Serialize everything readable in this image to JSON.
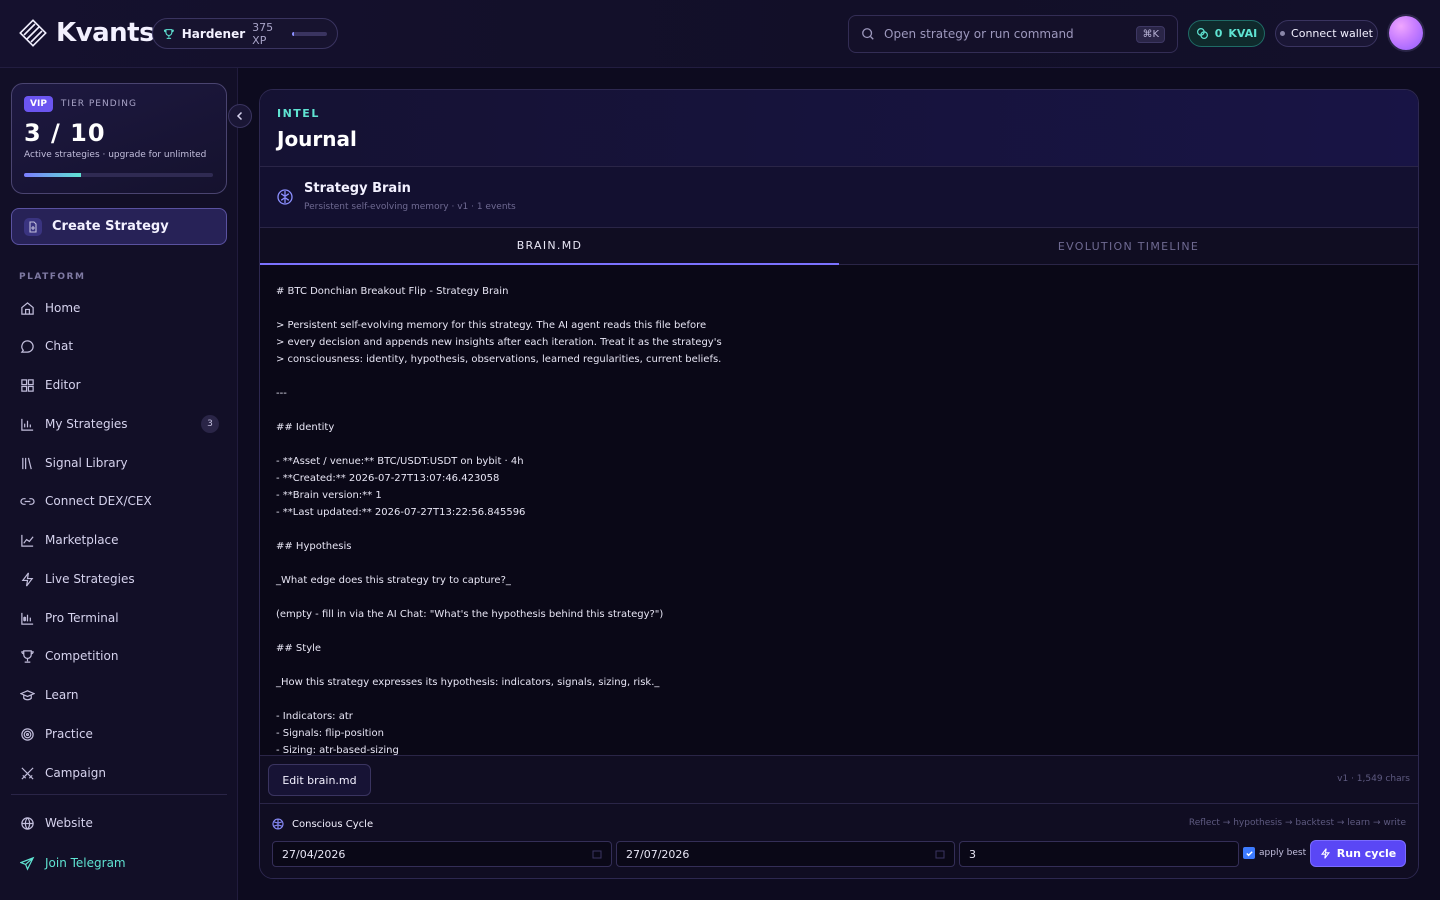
{
  "header": {
    "brand": "Kvants",
    "user_rank": "Hardener",
    "xp": "375 XP",
    "xp_progress": 0.06,
    "search_placeholder": "Open strategy or run command",
    "search_shortcut": "⌘K",
    "kvai_balance": "0",
    "kvai_unit": "KVAI",
    "connect_wallet": "Connect wallet"
  },
  "sidebar": {
    "vip_badge": "VIP",
    "tier_status": "TIER PENDING",
    "strategy_count": "3 / 10",
    "strategy_sub": "Active strategies · upgrade for unlimited",
    "strategy_progress": 0.3,
    "create_label": "Create Strategy",
    "section_label": "PLATFORM",
    "items": [
      {
        "label": "Home",
        "icon": "home-icon"
      },
      {
        "label": "Chat",
        "icon": "chat-icon"
      },
      {
        "label": "Editor",
        "icon": "grid-icon"
      },
      {
        "label": "My Strategies",
        "icon": "bar-chart-icon",
        "badge": "3"
      },
      {
        "label": "Signal Library",
        "icon": "library-icon"
      },
      {
        "label": "Connect DEX/CEX",
        "icon": "link-icon"
      },
      {
        "label": "Marketplace",
        "icon": "trend-icon"
      },
      {
        "label": "Live Strategies",
        "icon": "bolt-icon"
      },
      {
        "label": "Pro Terminal",
        "icon": "terminal-icon"
      },
      {
        "label": "Competition",
        "icon": "trophy-icon"
      },
      {
        "label": "Learn",
        "icon": "graduation-icon"
      },
      {
        "label": "Practice",
        "icon": "target-icon"
      },
      {
        "label": "Campaign",
        "icon": "swords-icon"
      }
    ],
    "footer_items": [
      {
        "label": "Website",
        "icon": "globe-icon"
      },
      {
        "label": "Join Telegram",
        "icon": "send-icon"
      }
    ]
  },
  "main": {
    "eyebrow": "INTEL",
    "title": "Journal",
    "brain_title": "Strategy Brain",
    "brain_sub": "Persistent self-evolving memory · v1 · 1 events",
    "tabs": [
      {
        "label": "BRAIN.MD",
        "active": true
      },
      {
        "label": "EVOLUTION TIMELINE",
        "active": false
      }
    ],
    "brain_lines": [
      "# BTC Donchian Breakout Flip - Strategy Brain",
      "",
      "> Persistent self-evolving memory for this strategy. The AI agent reads this file before",
      "> every decision and appends new insights after each iteration. Treat it as the strategy's",
      "> consciousness: identity, hypothesis, observations, learned regularities, current beliefs.",
      "",
      "---",
      "",
      "## Identity",
      "",
      "- **Asset / venue:** BTC/USDT:USDT on bybit · 4h",
      "- **Created:** 2026-07-27T13:07:46.423058",
      "- **Brain version:** 1",
      "- **Last updated:** 2026-07-27T13:22:56.845596",
      "",
      "## Hypothesis",
      "",
      "_What edge does this strategy try to capture?_",
      "",
      "(empty - fill in via the AI Chat: \"What's the hypothesis behind this strategy?\")",
      "",
      "## Style",
      "",
      "_How this strategy expresses its hypothesis: indicators, signals, sizing, risk._",
      "",
      "- Indicators: atr",
      "- Signals: flip-position",
      "- Sizing: atr-based-sizing"
    ],
    "edit_button": "Edit brain.md",
    "char_info": "v1 · 1,549 chars",
    "cycle_title": "Conscious Cycle",
    "cycle_hint": "Reflect → hypothesis → backtest → learn → write",
    "start_date": "27/04/2026",
    "end_date": "27/07/2026",
    "iterations": "3",
    "apply_best_label": "apply best",
    "apply_best_checked": true,
    "run_button": "Run cycle"
  }
}
